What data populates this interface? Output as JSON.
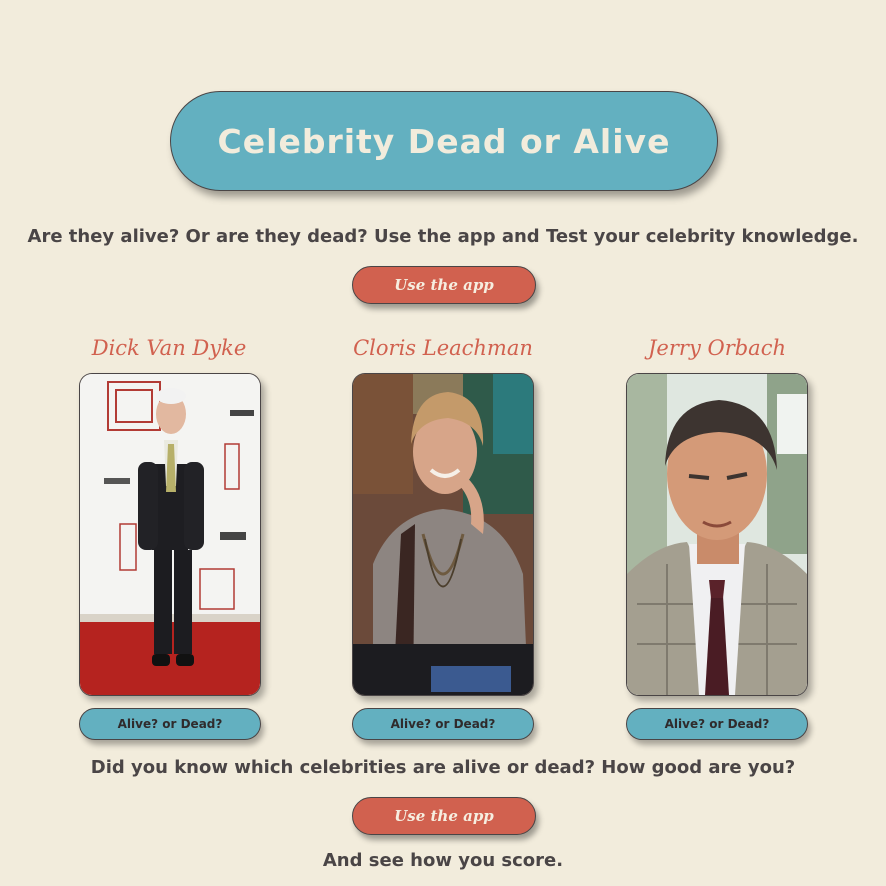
{
  "header": {
    "title": "Celebrity Dead or Alive"
  },
  "intro": {
    "tagline": "Are they alive? Or are they dead? Use the app and Test your celebrity knowledge.",
    "cta_label": "Use the app"
  },
  "celebrities": [
    {
      "name": "Dick Van Dyke",
      "button_label": "Alive? or Dead?"
    },
    {
      "name": "Cloris Leachman",
      "button_label": "Alive? or Dead?"
    },
    {
      "name": "Jerry Orbach",
      "button_label": "Alive? or Dead?"
    }
  ],
  "outro": {
    "question": "Did you know which celebrities are alive or dead? How good are you?",
    "cta_label": "Use the app",
    "footer": "And see how you score."
  },
  "colors": {
    "background": "#f2ecdc",
    "teal": "#63b0c0",
    "coral": "#d1614f",
    "text": "#4a4546"
  }
}
